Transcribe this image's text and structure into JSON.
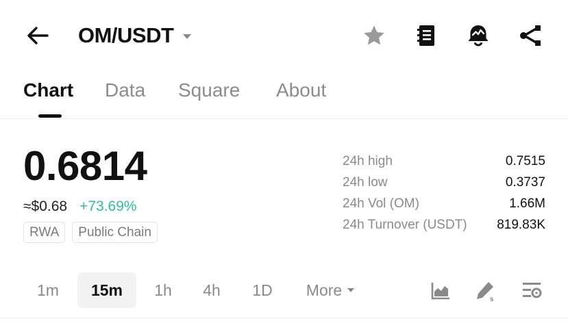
{
  "header": {
    "pair": "OM/USDT",
    "icons": [
      "back-arrow-icon",
      "caret-down-icon",
      "star-icon",
      "notebook-icon",
      "alarm-bell-icon",
      "share-icon"
    ]
  },
  "tabs": [
    {
      "label": "Chart",
      "active": true
    },
    {
      "label": "Data",
      "active": false
    },
    {
      "label": "Square",
      "active": false
    },
    {
      "label": "About",
      "active": false
    }
  ],
  "ticker": {
    "price": "0.6814",
    "usd_value": "≈$0.68",
    "change": "+73.69%",
    "tags": [
      "RWA",
      "Public Chain"
    ]
  },
  "stats": [
    {
      "label": "24h high",
      "value": "0.7515"
    },
    {
      "label": "24h low",
      "value": "0.3737"
    },
    {
      "label": "24h Vol (OM)",
      "value": "1.66M"
    },
    {
      "label": "24h Turnover (USDT)",
      "value": "819.83K"
    }
  ],
  "intervals": [
    {
      "label": "1m",
      "active": false
    },
    {
      "label": "15m",
      "active": true
    },
    {
      "label": "1h",
      "active": false
    },
    {
      "label": "4h",
      "active": false
    },
    {
      "label": "1D",
      "active": false
    },
    {
      "label": "More",
      "active": false
    }
  ],
  "tools": [
    "area-chart-icon",
    "drawing-pen-icon",
    "chart-settings-icon"
  ],
  "colors": {
    "positive": "#2ebd9f",
    "text_primary": "#111111",
    "text_secondary": "#8a8a8a",
    "active_bg": "#f2f2f2"
  }
}
